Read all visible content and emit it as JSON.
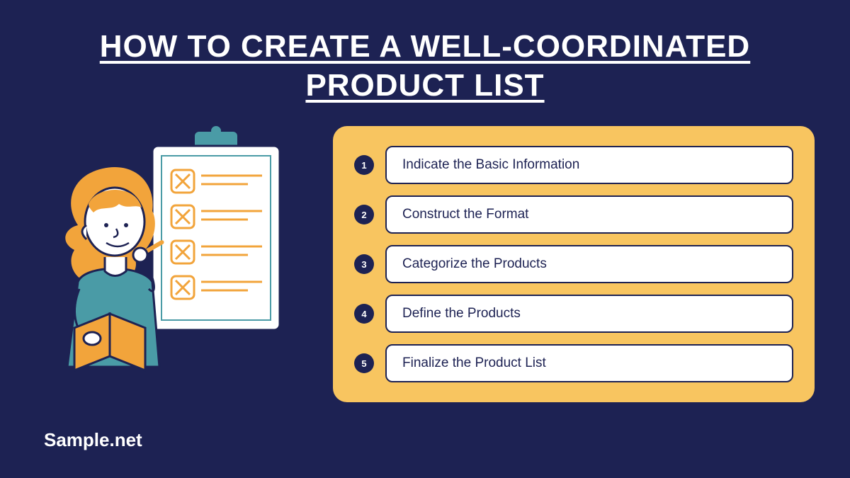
{
  "title_line1": "HOW TO CREATE A WELL-COORDINATED",
  "title_line2": "PRODUCT LIST",
  "brand": "Sample.net",
  "steps": [
    {
      "num": "1",
      "label": "Indicate the Basic Information"
    },
    {
      "num": "2",
      "label": "Construct the Format"
    },
    {
      "num": "3",
      "label": "Categorize the Products"
    },
    {
      "num": "4",
      "label": "Define the Products"
    },
    {
      "num": "5",
      "label": "Finalize the Product List"
    }
  ],
  "colors": {
    "bg": "#1d2253",
    "panel": "#f8c560",
    "accent_teal": "#4a9ba6",
    "hair": "#f2a43b"
  }
}
